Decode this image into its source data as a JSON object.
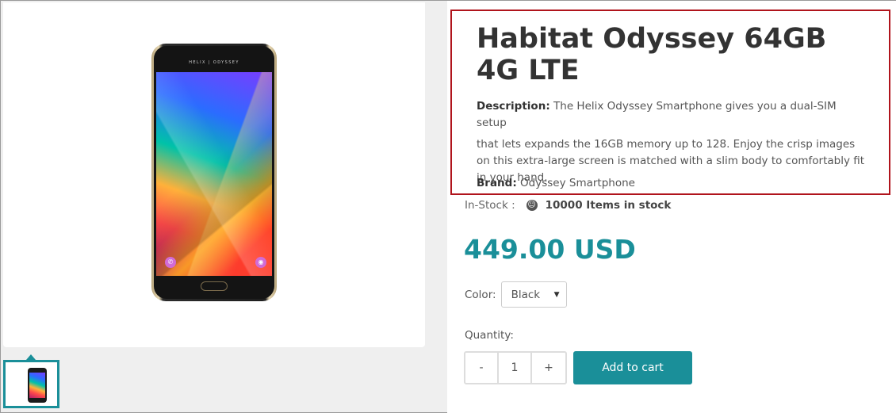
{
  "product": {
    "title": "Habitat Odyssey 64GB 4G LTE",
    "description_label": "Description:",
    "description_first": "The Helix Odyssey Smartphone gives you a dual-SIM setup",
    "description_rest": "that lets expands the 16GB memory up to 128. Enjoy the crisp images on this extra-large screen is matched with a slim body to comfortably fit in your hand.",
    "brand_label": "Brand:",
    "brand_value": "Odyssey Smartphone",
    "stock_label": "In-Stock :",
    "stock_icon": "smile-icon",
    "stock_value": "10000 Items in stock",
    "price": "449.00 USD",
    "price_color": "#1a8f99"
  },
  "image": {
    "phone_brand_text": "HELIX | ODYSSEY",
    "call_icon": "phone-icon",
    "camera_icon": "camera-icon"
  },
  "options": {
    "color_label": "Color:",
    "color_selected": "Black",
    "quantity_label": "Quantity:",
    "quantity_value": "1",
    "minus_label": "-",
    "plus_label": "+",
    "add_to_cart_label": "Add to cart"
  },
  "colors": {
    "accent": "#1a8f99",
    "highlight_border": "#b0141c"
  }
}
